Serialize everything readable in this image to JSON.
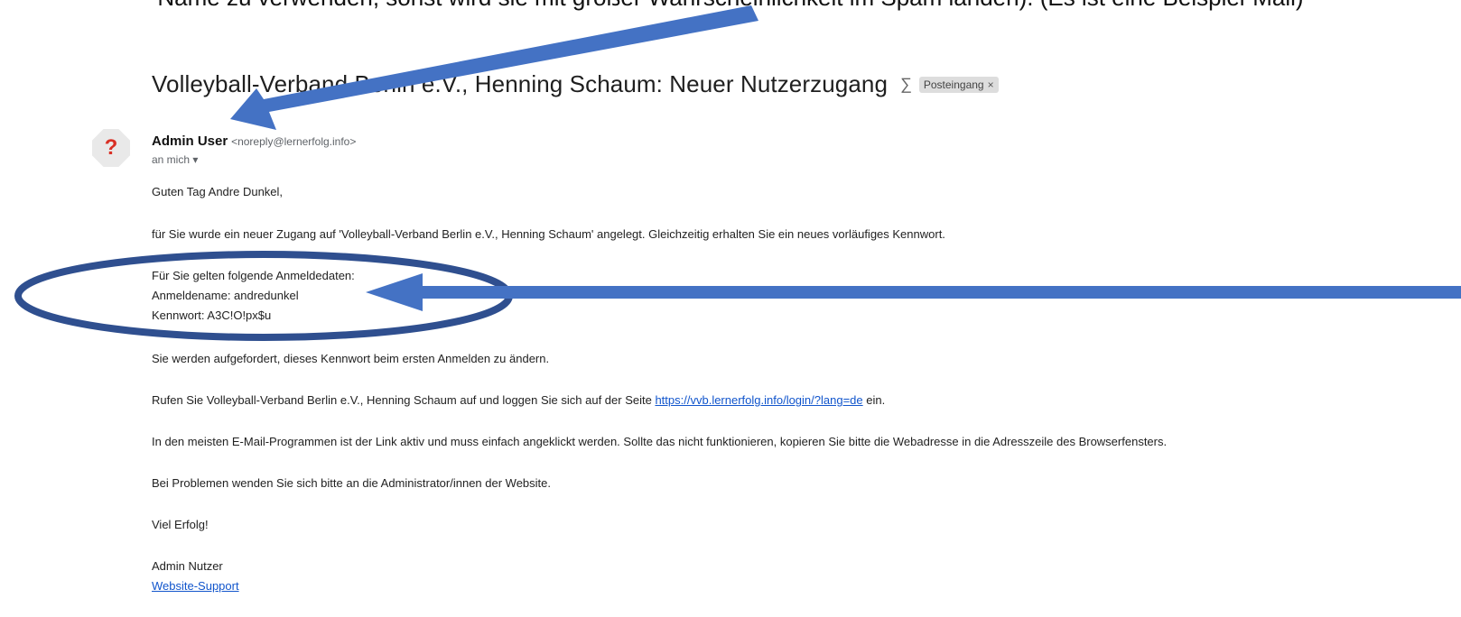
{
  "caption": "Name zu verwenden, sonst wird sie mit großer Wahrscheinlichkeit im Spam landen). (Es ist eine Beispiel-Mail)",
  "email": {
    "subject": "Volleyball-Verband Berlin e.V., Henning Schaum: Neuer Nutzerzugang",
    "important_icon": "label-important-icon",
    "label": "Posteingang",
    "label_remove": "×",
    "avatar_char": "?",
    "sender_name": "Admin User",
    "sender_email": "<noreply@lernerfolg.info>",
    "recipient": "an mich",
    "body": {
      "greeting": "Guten Tag Andre Dunkel,",
      "intro": "für Sie wurde ein neuer Zugang auf 'Volleyball-Verband Berlin e.V., Henning Schaum' angelegt. Gleichzeitig erhalten Sie ein neues vorläufiges Kennwort.",
      "credentials_heading": "Für Sie gelten folgende Anmeldedaten:",
      "username_line": "Anmeldename: andredunkel",
      "password_line": "Kennwort: A3C!O!px$u",
      "change_notice": "Sie werden aufgefordert, dieses Kennwort beim ersten Anmelden zu ändern.",
      "login_prefix": "Rufen Sie Volleyball-Verband Berlin e.V., Henning Schaum auf und loggen Sie sich auf der Seite",
      "login_url": "https://vvb.lernerfolg.info/login/?lang=de",
      "login_suffix": "ein.",
      "link_hint": "In den meisten E-Mail-Programmen ist der Link aktiv und muss einfach angeklickt werden. Sollte das nicht funktionieren, kopieren Sie bitte die Webadresse in die Adresszeile des Browserfensters.",
      "problems": "Bei Problemen wenden Sie sich bitte an die Administrator/innen der Website.",
      "closing": "Viel Erfolg!",
      "signature_name": "Admin Nutzer",
      "signature_link": "Website-Support"
    }
  },
  "annotation_color": "#4472c4",
  "annotation_ellipse_color": "#2f4f8f"
}
